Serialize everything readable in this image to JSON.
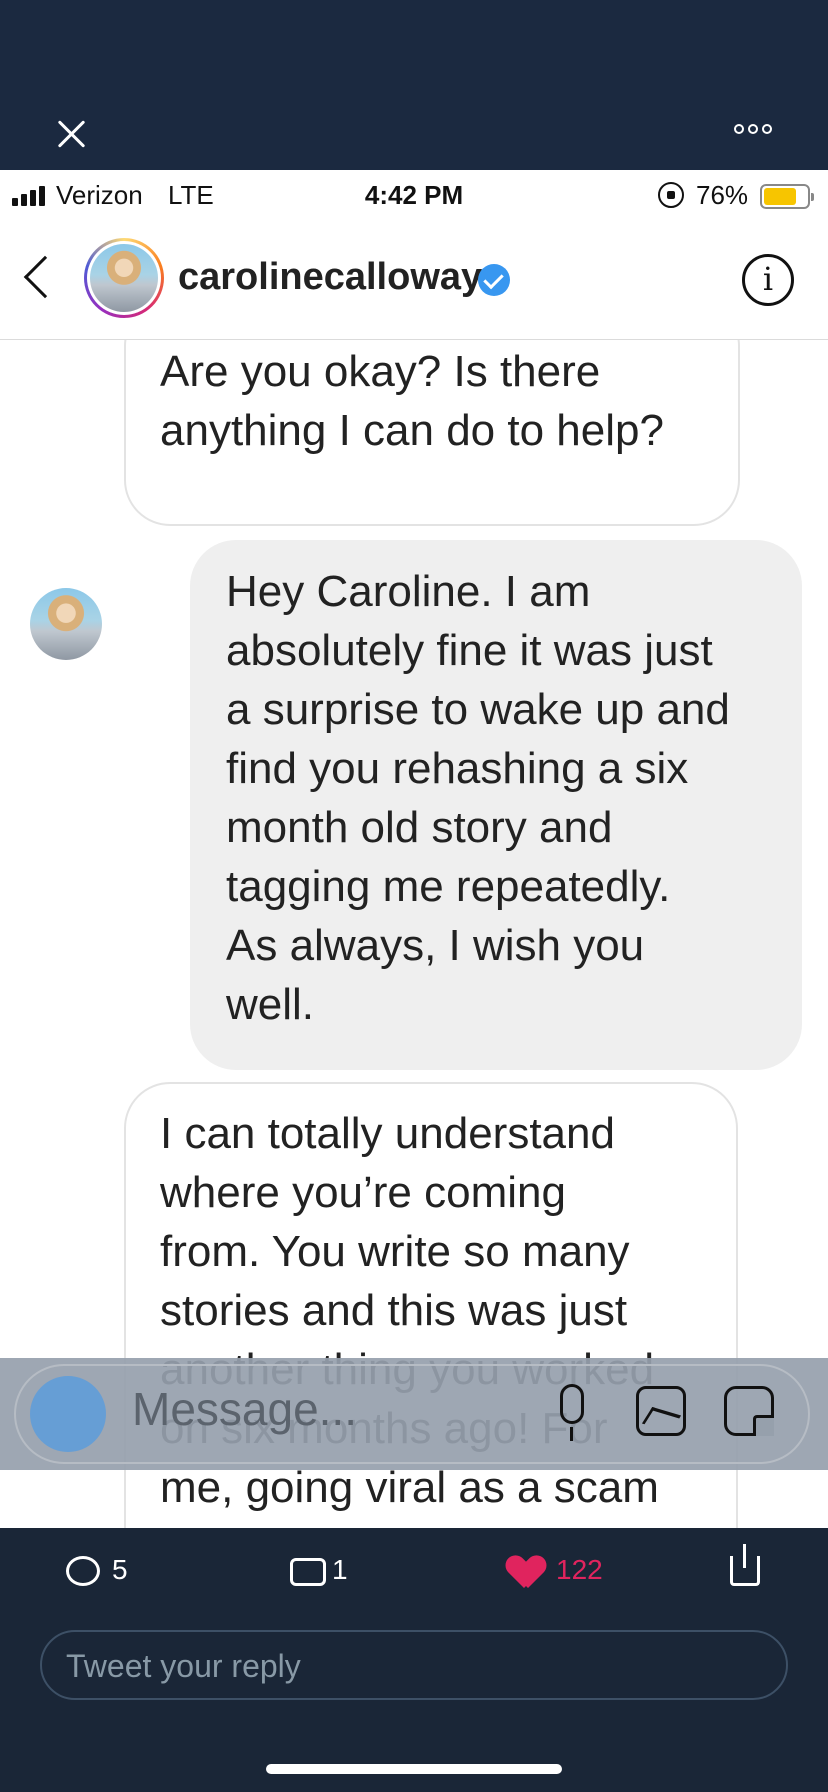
{
  "status_bar": {
    "carrier": "Verizon",
    "network": "LTE",
    "time": "4:42 PM",
    "battery_percent": "76%",
    "battery_level": 0.76
  },
  "dm_header": {
    "username": "carolinecalloway",
    "verified": true,
    "info_glyph": "i"
  },
  "messages": [
    {
      "direction": "incoming",
      "text": "Are you okay? Is there\nanything I can do to help?"
    },
    {
      "direction": "outgoing",
      "text": "Hey Caroline. I am\nabsolutely fine it was just\na surprise to wake up and\nfind you rehashing a six\nmonth old story and\ntagging me repeatedly.\nAs always, I wish you\nwell."
    },
    {
      "direction": "incoming",
      "text": "I can totally understand\nwhere you’re coming\nfrom. You write so many\nstories and this was just\nanother thing you worked\non six months ago! For\nme, going viral as a scam"
    }
  ],
  "composer": {
    "placeholder": "Message..."
  },
  "tweet_actions": {
    "replies": "5",
    "retweets": "1",
    "likes": "122"
  },
  "tweet_reply": {
    "placeholder": "Tweet your reply"
  },
  "colors": {
    "twitter_bg": "#1b2940",
    "like_red": "#e0245e",
    "verified_blue": "#3897f0",
    "battery_yellow": "#f7c500"
  }
}
